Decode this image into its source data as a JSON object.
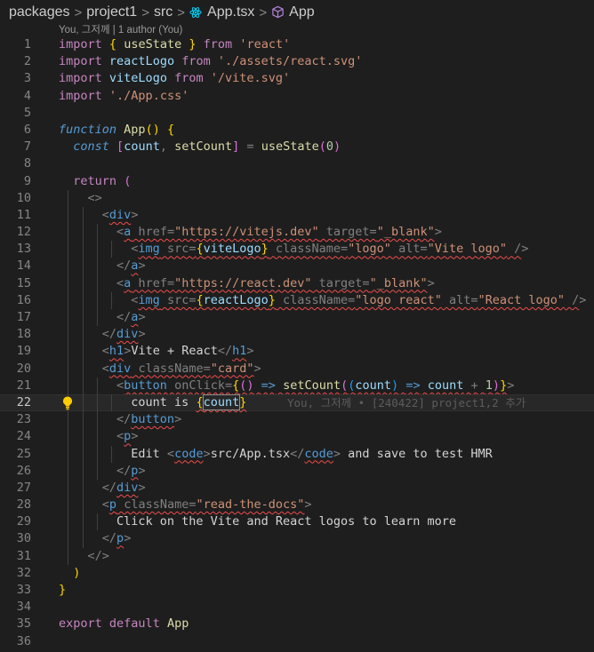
{
  "breadcrumb": {
    "items": [
      "packages",
      "project1",
      "src",
      "App.tsx",
      "App"
    ],
    "separator": ">"
  },
  "codelens": "You, 그저께 | 1 author (You)",
  "blame": {
    "line": 22,
    "text": "You, 그저께 • [240422] project1,2 추가"
  },
  "editor": {
    "current_line": 22,
    "line_numbers": [
      "1",
      "2",
      "3",
      "4",
      "5",
      "6",
      "7",
      "8",
      "9",
      "10",
      "11",
      "12",
      "13",
      "14",
      "15",
      "16",
      "17",
      "18",
      "19",
      "20",
      "21",
      "22",
      "23",
      "24",
      "25",
      "26",
      "27",
      "28",
      "29",
      "30",
      "31",
      "32",
      "33",
      "34",
      "35",
      "36"
    ],
    "lines": [
      "import { useState } from 'react'",
      "import reactLogo from './assets/react.svg'",
      "import viteLogo from '/vite.svg'",
      "import './App.css'",
      "",
      "function App() {",
      "  const [count, setCount] = useState(0)",
      "",
      "  return (",
      "    <>",
      "      <div>",
      "        <a href=\"https://vitejs.dev\" target=\"_blank\">",
      "          <img src={viteLogo} className=\"logo\" alt=\"Vite logo\" />",
      "        </a>",
      "        <a href=\"https://react.dev\" target=\"_blank\">",
      "          <img src={reactLogo} className=\"logo react\" alt=\"React logo\" />",
      "        </a>",
      "      </div>",
      "      <h1>Vite + React</h1>",
      "      <div className=\"card\">",
      "        <button onClick={() => setCount((count) => count + 1)}>",
      "          count is {count}",
      "        </button>",
      "        <p>",
      "          Edit <code>src/App.tsx</code> and save to test HMR",
      "        </p>",
      "      </div>",
      "      <p className=\"read-the-docs\">",
      "        Click on the Vite and React logos to learn more",
      "      </p>",
      "    </>",
      "  )",
      "}",
      "",
      "export default App",
      ""
    ]
  },
  "colors": {
    "background": "#1e1e1e",
    "keyword_control": "#c586c0",
    "keyword_storage": "#569cd6",
    "function": "#dcdcaa",
    "variable": "#9cdcfe",
    "string": "#ce9178",
    "number": "#b5cea8",
    "error_squiggle": "#f14c4c",
    "bracket_gold": "#ffd700",
    "bracket_orchid": "#da70d6",
    "bracket_blue": "#179fff"
  },
  "icons": [
    "react-icon",
    "symbol-class-icon",
    "lightbulb-icon"
  ]
}
